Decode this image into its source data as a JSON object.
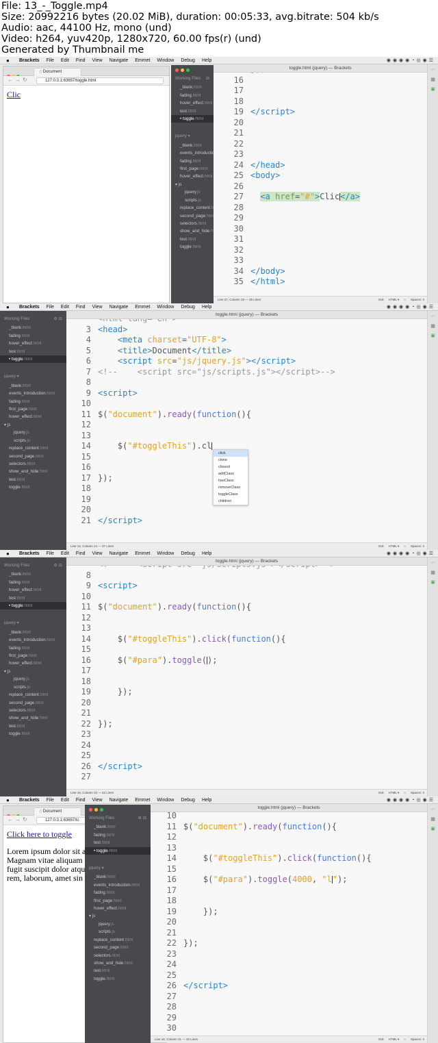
{
  "header": {
    "lines": [
      "File: 13_-_Toggle.mp4",
      "Size: 20992216 bytes (20.02 MiB), duration: 00:05:33, avg.bitrate: 504 kb/s",
      "Audio: aac, 44100 Hz, mono (und)",
      "Video: h264, yuv420p, 1280x720, 60.00 fps(r) (und)",
      "Generated by Thumbnail me"
    ]
  },
  "menubar": {
    "app": "Brackets",
    "items": [
      "File",
      "Edit",
      "Find",
      "View",
      "Navigate",
      "Emmet",
      "Window",
      "Debug",
      "Help"
    ]
  },
  "colors": {
    "close": "#fc605b",
    "minimize": "#fdbc40",
    "maximize": "#34c84a",
    "sidebar_bg": "#47494d",
    "editor_bg": "#f8f8f8",
    "link": "#1a0dab"
  },
  "icons": {
    "apple": "apple-icon",
    "tray": "menu-tray-icons",
    "live_preview": "lightning-icon",
    "extensions": "extension-manager-icon",
    "gift": "gift-icon"
  },
  "window_title": "toggle.html (jquery) — Brackets",
  "sidebar": {
    "working_files_label": "Working Files",
    "project_label": "jquery ▾",
    "wf_f1": [
      {
        "name": "_blank",
        "ext": ".html",
        "selected": false
      },
      {
        "name": "fading",
        "ext": ".html",
        "selected": false
      },
      {
        "name": "hover_effect",
        "ext": ".html",
        "selected": false
      },
      {
        "name": "test",
        "ext": ".html",
        "selected": false
      },
      {
        "name": "toggle",
        "ext": ".html",
        "selected": true
      }
    ],
    "wf_f4": [
      {
        "name": "_blank",
        "ext": ".html",
        "selected": false
      },
      {
        "name": "fading",
        "ext": ".html",
        "selected": false
      },
      {
        "name": "test",
        "ext": ".html",
        "selected": false
      },
      {
        "name": "toggle",
        "ext": ".html",
        "selected": true
      }
    ],
    "tree": [
      {
        "name": "_blank",
        "ext": ".html",
        "level": "f"
      },
      {
        "name": "events_introduction",
        "ext": ".html",
        "level": "f"
      },
      {
        "name": "fading",
        "ext": ".html",
        "level": "f"
      },
      {
        "name": "first_page",
        "ext": ".html",
        "level": "f"
      },
      {
        "name": "hover_effect",
        "ext": ".html",
        "level": "f"
      },
      {
        "name": "▾ js",
        "ext": "",
        "level": "dir"
      },
      {
        "name": "jquery",
        "ext": ".js",
        "level": "sub"
      },
      {
        "name": "scripts",
        "ext": ".js",
        "level": "sub"
      },
      {
        "name": "replace_content",
        "ext": ".html",
        "level": "f"
      },
      {
        "name": "second_page",
        "ext": ".html",
        "level": "f"
      },
      {
        "name": "selectors",
        "ext": ".html",
        "level": "f"
      },
      {
        "name": "show_and_hide",
        "ext": ".html",
        "level": "f"
      },
      {
        "name": "test",
        "ext": ".html",
        "level": "f"
      },
      {
        "name": "toggle",
        "ext": ".html",
        "level": "f"
      }
    ]
  },
  "browser": {
    "tab_title": "Document",
    "url_f1": "127.0.0.1:63657/toggle.html",
    "url_f4": "127.0.0.1:63657/tc",
    "link_f1": "Clic",
    "link_f4": "Click here to toggle",
    "para_lines": [
      "Lorem ipsum dolor sit a",
      "Magnam vitae aliquam",
      "fugit suscipit dolor atqu",
      "rem, laborum, amet sin"
    ]
  },
  "frames": [
    {
      "lines": [
        {
          "n": "16",
          "html": ""
        },
        {
          "n": "17",
          "html": ""
        },
        {
          "n": "18",
          "html": ""
        },
        {
          "n": "19",
          "html": "<span class='tg'>&lt;/script&gt;</span>"
        },
        {
          "n": "20",
          "html": ""
        },
        {
          "n": "21",
          "html": ""
        },
        {
          "n": "22",
          "html": ""
        },
        {
          "n": "23",
          "html": ""
        },
        {
          "n": "24",
          "html": "<span class='tg'>&lt;/head&gt;</span>"
        },
        {
          "n": "25",
          "html": "<span class='tg'>&lt;body&gt;</span>"
        },
        {
          "n": "26",
          "html": ""
        },
        {
          "n": "27",
          "html": "  <span class='hl'><span class='tg'>&lt;a</span> <span class='ct'>href</span>=<span class='st'>\"#\"</span><span class='tg'>&gt;</span></span>Clic<span class='cursor'></span><span class='hl'><span class='tg'>&lt;/a&gt;</span></span>"
        },
        {
          "n": "28",
          "html": ""
        },
        {
          "n": "29",
          "html": ""
        },
        {
          "n": "30",
          "html": ""
        },
        {
          "n": "31",
          "html": ""
        },
        {
          "n": "32",
          "html": ""
        },
        {
          "n": "33",
          "html": ""
        },
        {
          "n": "34",
          "html": "<span class='tg'>&lt;/body&gt;</span>"
        },
        {
          "n": "35",
          "html": "<span class='tg'>&lt;/html&gt;</span>"
        }
      ],
      "status": "Line 27, Column 19 — 35 Lines",
      "top_partial": "});"
    },
    {
      "lines": [
        {
          "n": "3",
          "html": "<span class='tg'>&lt;head&gt;</span>"
        },
        {
          "n": "4",
          "html": "    <span class='tg'>&lt;meta</span> <span class='at'>charset</span>=<span class='st'>\"UTF-8\"</span><span class='tg'>&gt;</span>"
        },
        {
          "n": "5",
          "html": "    <span class='tg'>&lt;title&gt;</span>Document<span class='tg'>&lt;/title&gt;</span>"
        },
        {
          "n": "6",
          "html": "    <span class='tg'>&lt;script</span> <span class='at'>src</span>=<span class='st'>\"js/jquery.js\"</span><span class='tg'>&gt;&lt;/script&gt;</span>"
        },
        {
          "n": "7",
          "html": "<span class='cm'>&lt;!--    &lt;script src=\"js/scripts.js\"&gt;&lt;/script&gt;--&gt;</span>"
        },
        {
          "n": "8",
          "html": ""
        },
        {
          "n": "9",
          "html": "<span class='tg'>&lt;script&gt;</span>"
        },
        {
          "n": "10",
          "html": ""
        },
        {
          "n": "11",
          "html": "$(<span class='st'>\"document\"</span>).<span class='fn'>ready</span>(<span class='kw'>function</span>(){"
        },
        {
          "n": "12",
          "html": ""
        },
        {
          "n": "13",
          "html": ""
        },
        {
          "n": "14",
          "html": "    $(<span class='st'>\"#toggleThis\"</span>).cl<span class='cursor'></span>"
        },
        {
          "n": "15",
          "html": ""
        },
        {
          "n": "16",
          "html": ""
        },
        {
          "n": "17",
          "html": "});"
        },
        {
          "n": "18",
          "html": ""
        },
        {
          "n": "19",
          "html": ""
        },
        {
          "n": "20",
          "html": ""
        },
        {
          "n": "21",
          "html": "<span class='tg'>&lt;/script&gt;</span>"
        }
      ],
      "status": "Line 14, Column 24 — 37 Lines",
      "top_partial": "&lt;html lang=\"en\"&gt;",
      "autocomplete": [
        "click",
        "clone",
        "closest",
        "addClass",
        "hasClass",
        "removeClass",
        "toggleClass",
        "children"
      ]
    },
    {
      "lines": [
        {
          "n": "8",
          "html": ""
        },
        {
          "n": "9",
          "html": "<span class='tg'>&lt;script&gt;</span>"
        },
        {
          "n": "10",
          "html": ""
        },
        {
          "n": "11",
          "html": "$(<span class='st'>\"document\"</span>).<span class='fn'>ready</span>(<span class='kw'>function</span>(){"
        },
        {
          "n": "12",
          "html": ""
        },
        {
          "n": "13",
          "html": ""
        },
        {
          "n": "14",
          "html": "    $(<span class='st'>\"#toggleThis\"</span>).<span class='fn'>click</span>(<span class='kw'>function</span>(){"
        },
        {
          "n": "15",
          "html": ""
        },
        {
          "n": "16",
          "html": "    $(<span class='st'>\"#para\"</span>).<span class='fn'>toggle</span>(<span class='cursor'></span>);"
        },
        {
          "n": "17",
          "html": ""
        },
        {
          "n": "18",
          "html": ""
        },
        {
          "n": "19",
          "html": "    });"
        },
        {
          "n": "20",
          "html": ""
        },
        {
          "n": "21",
          "html": ""
        },
        {
          "n": "22",
          "html": "});"
        },
        {
          "n": "23",
          "html": ""
        },
        {
          "n": "24",
          "html": ""
        },
        {
          "n": "25",
          "html": ""
        },
        {
          "n": "26",
          "html": "<span class='tg'>&lt;/script&gt;</span>"
        },
        {
          "n": "27",
          "html": ""
        }
      ],
      "status": "Line 16, Column 23 — 42 Lines",
      "top_partial": "&lt;!--    &lt;script src=\"js/scripts.js\"&gt;&lt;/script&gt;--&gt;"
    },
    {
      "lines": [
        {
          "n": "10",
          "html": ""
        },
        {
          "n": "11",
          "html": "$(<span class='st'>\"document\"</span>).<span class='fn'>ready</span>(<span class='kw'>function</span>(){"
        },
        {
          "n": "12",
          "html": ""
        },
        {
          "n": "13",
          "html": ""
        },
        {
          "n": "14",
          "html": "    $(<span class='st'>\"#toggleThis\"</span>).<span class='fn'>click</span>(<span class='kw'>function</span>(){"
        },
        {
          "n": "15",
          "html": ""
        },
        {
          "n": "16",
          "html": "    $(<span class='st'>\"#para\"</span>).<span class='fn'>toggle</span>(<span class='at'>4000</span>, <span class='st'>\"l<span class='cursor'></span>\"</span>);"
        },
        {
          "n": "17",
          "html": ""
        },
        {
          "n": "18",
          "html": ""
        },
        {
          "n": "19",
          "html": "    });"
        },
        {
          "n": "20",
          "html": ""
        },
        {
          "n": "21",
          "html": ""
        },
        {
          "n": "22",
          "html": "});"
        },
        {
          "n": "23",
          "html": ""
        },
        {
          "n": "24",
          "html": ""
        },
        {
          "n": "25",
          "html": ""
        },
        {
          "n": "26",
          "html": "<span class='tg'>&lt;/script&gt;</span>"
        },
        {
          "n": "27",
          "html": ""
        },
        {
          "n": "28",
          "html": ""
        },
        {
          "n": "29",
          "html": ""
        },
        {
          "n": "30",
          "html": ""
        }
      ],
      "status": "Line 16, Column 31 — 42 Lines",
      "top_partial": ""
    }
  ],
  "status_right": [
    "INS",
    "HTML ▾",
    "○",
    "Spaces: 4"
  ]
}
